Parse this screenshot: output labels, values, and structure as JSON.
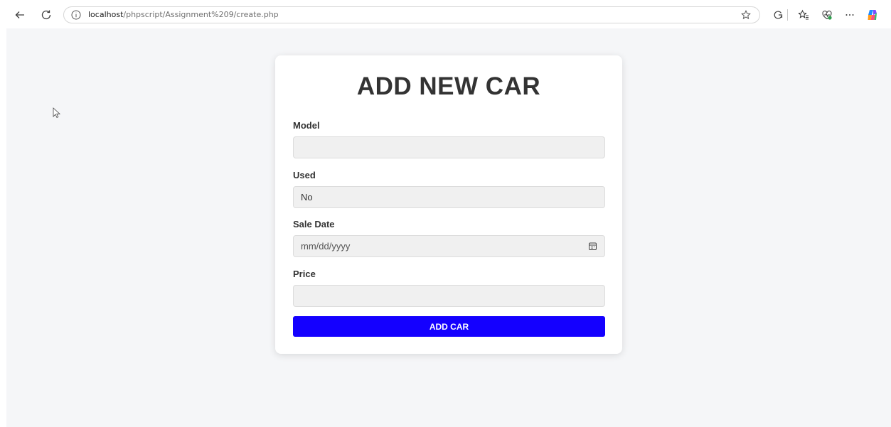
{
  "browser": {
    "url_host": "localhost",
    "url_path": "/phpscript/Assignment%209/create.php"
  },
  "form": {
    "title": "ADD NEW CAR",
    "fields": [
      {
        "label": "Model",
        "value": ""
      },
      {
        "label": "Used",
        "value": "No"
      },
      {
        "label": "Sale Date",
        "placeholder": "mm/dd/yyyy"
      },
      {
        "label": "Price",
        "value": ""
      }
    ],
    "submit_label": "ADD CAR"
  },
  "colors": {
    "submit_button": "#1400ff",
    "page_background": "#f5f6f8",
    "title_text": "#333333"
  },
  "icons": [
    "back-arrow-icon",
    "refresh-icon",
    "info-icon",
    "star-icon",
    "collections-icon",
    "favorites-icon",
    "heart-pulse-icon",
    "more-icon",
    "copilot-icon",
    "calendar-icon",
    "mouse-cursor-icon"
  ]
}
